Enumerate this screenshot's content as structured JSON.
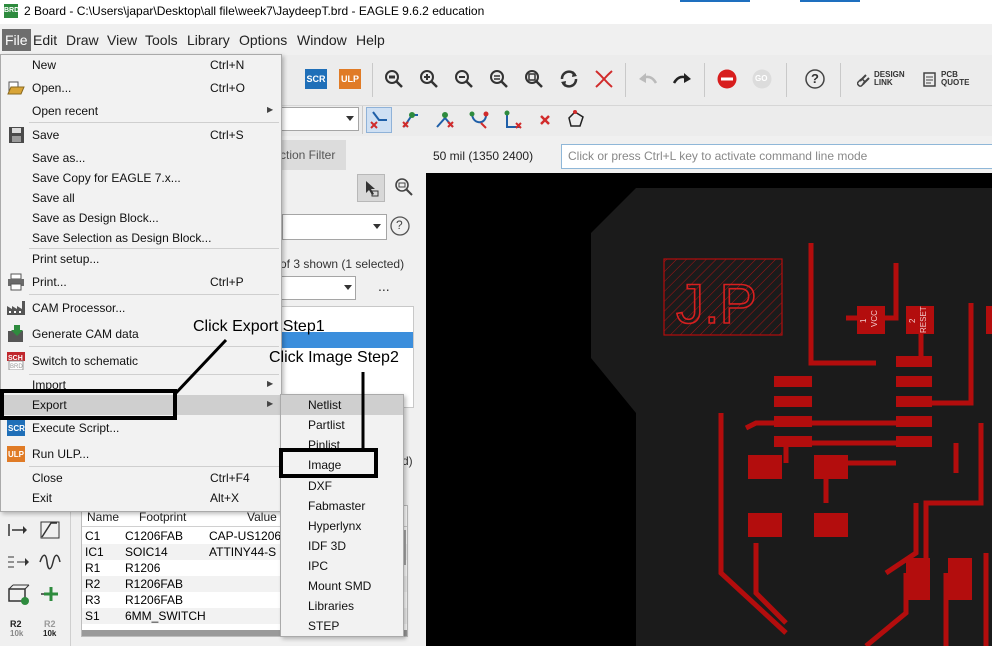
{
  "window": {
    "title": "2 Board - C:\\Users\\japar\\Desktop\\all file\\week7\\JaydeepT.brd - EAGLE 9.6.2 education",
    "app_icon_text": "BRD"
  },
  "menubar": [
    "File",
    "Edit",
    "Draw",
    "View",
    "Tools",
    "Library",
    "Options",
    "Window",
    "Help"
  ],
  "toolbar": {
    "scr_label": "SCR",
    "ulp_label": "ULP",
    "design_link": [
      "DESIGN",
      "LINK"
    ],
    "pcb_quote": [
      "PCB",
      "QUOTE"
    ],
    "help_label": "?",
    "go_label": "GO"
  },
  "status": {
    "coordinates": "50 mil (1350 2400)",
    "command_placeholder": "Click or press Ctrl+L key to activate command line mode"
  },
  "panel": {
    "tab_label": "ction Filter",
    "shown_text": "of 3 shown (1 selected)",
    "ellipsis": "...",
    "help_label": "?",
    "clipped_letter": "d)"
  },
  "table": {
    "headers": [
      "Name",
      "Footprint",
      "Value"
    ],
    "rows": [
      {
        "name": "C1",
        "footprint": "C1206FAB",
        "value": "CAP-US1206"
      },
      {
        "name": "IC1",
        "footprint": "SOIC14",
        "value": "ATTINY44-S"
      },
      {
        "name": "R1",
        "footprint": "R1206",
        "value": ""
      },
      {
        "name": "R2",
        "footprint": "R1206FAB",
        "value": ""
      },
      {
        "name": "R3",
        "footprint": "R1206FAB",
        "value": ""
      },
      {
        "name": "S1",
        "footprint": "6MM_SWITCH",
        "value": ""
      }
    ]
  },
  "tools": {
    "r2_label": "R2",
    "r2_value": "10k",
    "r2b_label": "R2",
    "r2b_value": "10k"
  },
  "file_menu": [
    {
      "label": "New",
      "shortcut": "Ctrl+N"
    },
    {
      "label": "Open...",
      "shortcut": "Ctrl+O"
    },
    {
      "label": "Open recent",
      "submenu": true
    },
    {
      "label": "Save",
      "shortcut": "Ctrl+S"
    },
    {
      "label": "Save as...",
      "shortcut": ""
    },
    {
      "label": "Save Copy for EAGLE 7.x...",
      "shortcut": ""
    },
    {
      "label": "Save all",
      "shortcut": ""
    },
    {
      "label": "Save as Design Block...",
      "shortcut": ""
    },
    {
      "label": "Save Selection as Design Block...",
      "shortcut": ""
    },
    {
      "label": "Print setup...",
      "shortcut": ""
    },
    {
      "label": "Print...",
      "shortcut": "Ctrl+P"
    },
    {
      "label": "CAM Processor...",
      "shortcut": ""
    },
    {
      "label": "Generate CAM data",
      "shortcut": ""
    },
    {
      "label": "Switch to schematic",
      "shortcut": ""
    },
    {
      "label": "Import",
      "submenu": true
    },
    {
      "label": "Export",
      "submenu": true
    },
    {
      "label": "Execute Script...",
      "shortcut": ""
    },
    {
      "label": "Run ULP...",
      "shortcut": ""
    },
    {
      "label": "Close",
      "shortcut": "Ctrl+F4"
    },
    {
      "label": "Exit",
      "shortcut": "Alt+X"
    }
  ],
  "export_submenu": [
    "Netlist",
    "Partlist",
    "Pinlist",
    "Image",
    "DXF",
    "Fabmaster",
    "Hyperlynx",
    "IDF 3D",
    "IPC",
    "Mount SMD",
    "Libraries",
    "STEP"
  ],
  "annotations": {
    "step1": "Click Export Step1",
    "step2": "Click Image Step2"
  },
  "board": {
    "silk_text": "J.P",
    "pad_labels": [
      "1",
      "VCC",
      "2",
      "RESET"
    ],
    "colors": {
      "background": "#000000",
      "copper": "#b30d0d",
      "outline": "#1c1c1c"
    }
  }
}
